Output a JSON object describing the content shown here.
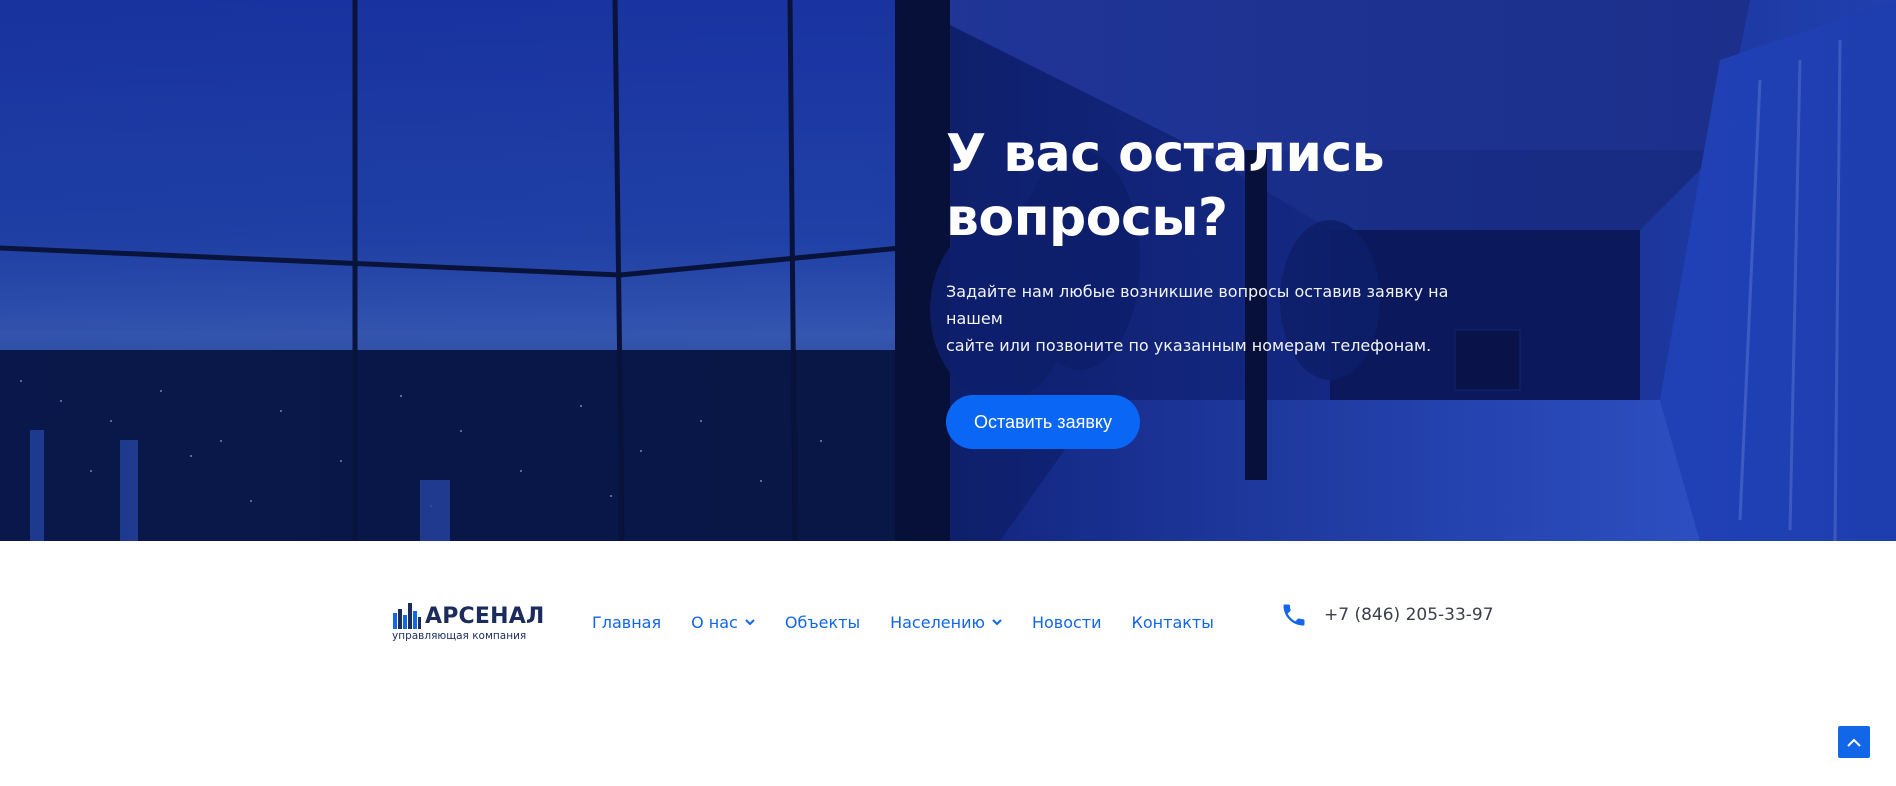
{
  "hero": {
    "title_line1": "У вас остались",
    "title_line2": "вопросы?",
    "text_line1": "Задайте нам любые возникшие вопросы оставив заявку на нашем",
    "text_line2": "сайте или позвоните по указанным номерам телефонам.",
    "cta_label": "Оставить заявку"
  },
  "header": {
    "logo": {
      "name": "АРСЕНАЛ",
      "subtitle": "управляющая компания"
    },
    "nav": [
      {
        "label": "Главная",
        "has_dropdown": false
      },
      {
        "label": "О нас",
        "has_dropdown": true
      },
      {
        "label": "Объекты",
        "has_dropdown": false
      },
      {
        "label": "Населению",
        "has_dropdown": true
      },
      {
        "label": "Новости",
        "has_dropdown": false
      },
      {
        "label": "Контакты",
        "has_dropdown": false
      }
    ],
    "phone": "+7 (846) 205-33-97",
    "phone_icon": "phone-icon"
  },
  "scroll_top_icon": "chevron-up-icon",
  "colors": {
    "accent": "#0a66f5",
    "nav_link": "#1266e8",
    "logo_text": "#1b2b5c",
    "phone_text": "#3a3f4a"
  }
}
